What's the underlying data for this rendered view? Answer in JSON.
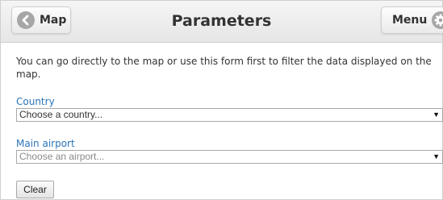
{
  "header": {
    "title": "Parameters",
    "map_button": {
      "label": "Map",
      "icon": "chevron-left-icon"
    },
    "menu_button": {
      "label": "Menu",
      "icon": "gear-icon"
    }
  },
  "intro_text": "You can go directly to the map or use this form first to filter the data displayed on the map.",
  "form": {
    "country": {
      "label": "Country",
      "selected": "Choose a country..."
    },
    "airport": {
      "label": "Main airport",
      "selected": "Choose an airport..."
    },
    "clear_label": "Clear"
  },
  "colors": {
    "label_blue": "#2a75b8",
    "icon_gray": "#a6a6a6",
    "header_bg": "#ececec"
  }
}
